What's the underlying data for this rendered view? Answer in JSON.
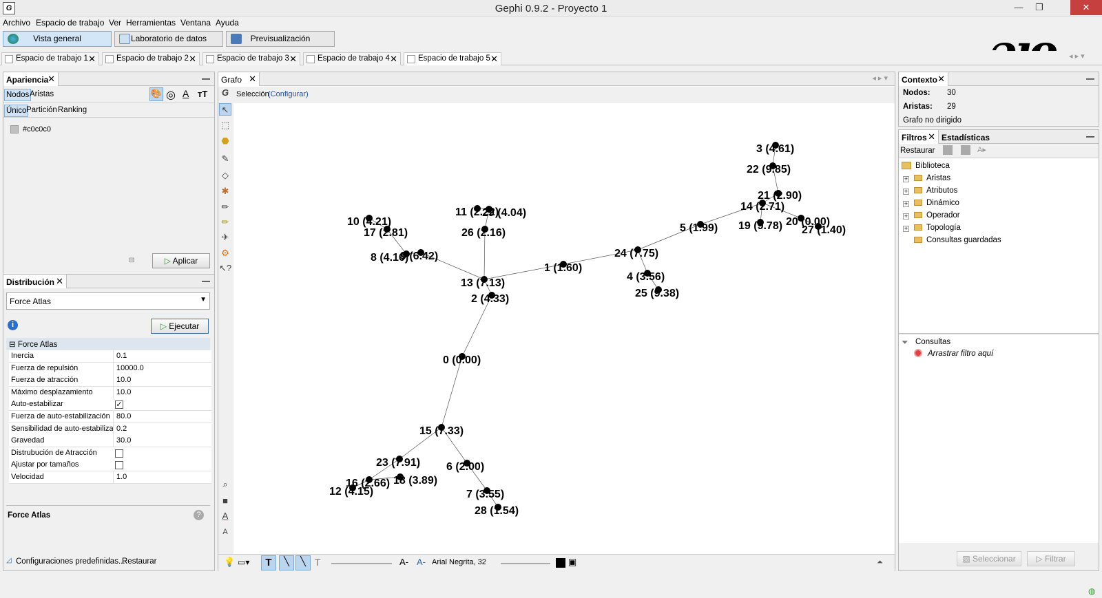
{
  "window": {
    "title": "Gephi 0.9.2 - Proyecto 1"
  },
  "menu": [
    "Archivo",
    "Espacio de trabajo",
    "Ver",
    "Herramientas",
    "Ventana",
    "Ayuda"
  ],
  "modes": [
    "Vista general",
    "Laboratorio de datos",
    "Previsualización"
  ],
  "workspaces": [
    "Espacio de trabajo 1",
    "Espacio de trabajo 2",
    "Espacio de trabajo 3",
    "Espacio de trabajo 4",
    "Espacio de trabajo 5"
  ],
  "appearance": {
    "tab": "Apariencia",
    "subtabs": [
      "Nodos",
      "Aristas"
    ],
    "modes": [
      "Único",
      "Partición",
      "Ranking"
    ],
    "color_value": "#c0c0c0",
    "apply_label": "Aplicar"
  },
  "layout": {
    "tab": "Distribución",
    "algorithm": "Force Atlas",
    "run_label": "Ejecutar",
    "section": "Force Atlas",
    "properties": [
      {
        "name": "Inercia",
        "value": "0.1"
      },
      {
        "name": "Fuerza de repulsión",
        "value": "10000.0"
      },
      {
        "name": "Fuerza de atracción",
        "value": "10.0"
      },
      {
        "name": "Máximo desplazamiento",
        "value": "10.0"
      },
      {
        "name": "Auto-estabilizar",
        "checked": true
      },
      {
        "name": "Fuerza de auto-estabilización",
        "value": "80.0"
      },
      {
        "name": "Sensibilidad de auto-estabiliza",
        "value": "0.2"
      },
      {
        "name": "Gravedad",
        "value": "30.0"
      },
      {
        "name": "Distrubución de Atracción",
        "checked": false
      },
      {
        "name": "Ajustar por tamaños",
        "checked": false
      },
      {
        "name": "Velocidad",
        "value": "1.0"
      }
    ],
    "desc_title": "Force Atlas",
    "presets_label": "Configuraciones predefinidas...",
    "reset_label": "Restaurar"
  },
  "graph": {
    "tab": "Grafo",
    "selection_label": "Selección",
    "configure_label": "(Configurar)",
    "font_label": "Arial Negrita, 32",
    "node_color": "#000000",
    "nodes": [
      {
        "label": "3 (4.61)"
      },
      {
        "label": "22 (9.85)"
      },
      {
        "label": "21 (2.90)"
      },
      {
        "label": "14 (2.71)"
      },
      {
        "label": "20 (0.00)"
      },
      {
        "label": "19 (9.78)"
      },
      {
        "label": "27 (1.40)"
      },
      {
        "label": "5 (1.99)"
      },
      {
        "label": "24 (7.75)"
      },
      {
        "label": "4 (3.56)"
      },
      {
        "label": "25 (9.38)"
      },
      {
        "label": "1 (1.60)"
      },
      {
        "label": "11 (2.22)"
      },
      {
        "label": "29 (4.04)"
      },
      {
        "label": "26 (2.16)"
      },
      {
        "label": "10 (4.21)"
      },
      {
        "label": "17 (2.81)"
      },
      {
        "label": "8 (4.16)"
      },
      {
        "label": "9 (6.42)"
      },
      {
        "label": "13 (7.13)"
      },
      {
        "label": "2 (4.33)"
      },
      {
        "label": "0 (0.00)"
      },
      {
        "label": "15 (7.33)"
      },
      {
        "label": "23 (7.91)"
      },
      {
        "label": "6 (2.00)"
      },
      {
        "label": "16 (2.66)"
      },
      {
        "label": "18 (3.89)"
      },
      {
        "label": "12 (4.15)"
      },
      {
        "label": "7 (3.55)"
      },
      {
        "label": "28 (1.54)"
      }
    ],
    "edges": [
      [
        0,
        1
      ],
      [
        1,
        2
      ],
      [
        2,
        3
      ],
      [
        3,
        4
      ],
      [
        3,
        5
      ],
      [
        4,
        6
      ],
      [
        3,
        7
      ],
      [
        7,
        8
      ],
      [
        8,
        9
      ],
      [
        9,
        10
      ],
      [
        8,
        11
      ],
      [
        11,
        19
      ],
      [
        12,
        13
      ],
      [
        13,
        14
      ],
      [
        14,
        19
      ],
      [
        15,
        16
      ],
      [
        16,
        17
      ],
      [
        17,
        18
      ],
      [
        18,
        19
      ],
      [
        19,
        20
      ],
      [
        20,
        21
      ],
      [
        21,
        22
      ],
      [
        22,
        23
      ],
      [
        22,
        24
      ],
      [
        23,
        25
      ],
      [
        25,
        26
      ],
      [
        25,
        27
      ],
      [
        24,
        28
      ],
      [
        28,
        29
      ]
    ]
  },
  "context": {
    "tab": "Contexto",
    "nodes_label": "Nodos:",
    "nodes_value": "30",
    "edges_label": "Aristas:",
    "edges_value": "29",
    "graph_type": "Grafo no dirigido"
  },
  "filters": {
    "tab": "Filtros",
    "stats_tab": "Estadísticas",
    "reset_label": "Restaurar",
    "library_label": "Biblioteca",
    "library": [
      "Aristas",
      "Atributos",
      "Dinámico",
      "Operador",
      "Topología",
      "Consultas guardadas"
    ],
    "queries_label": "Consultas",
    "drop_hint": "Arrastrar filtro aquí",
    "select_label": "Seleccionar",
    "filter_label": "Filtrar"
  }
}
